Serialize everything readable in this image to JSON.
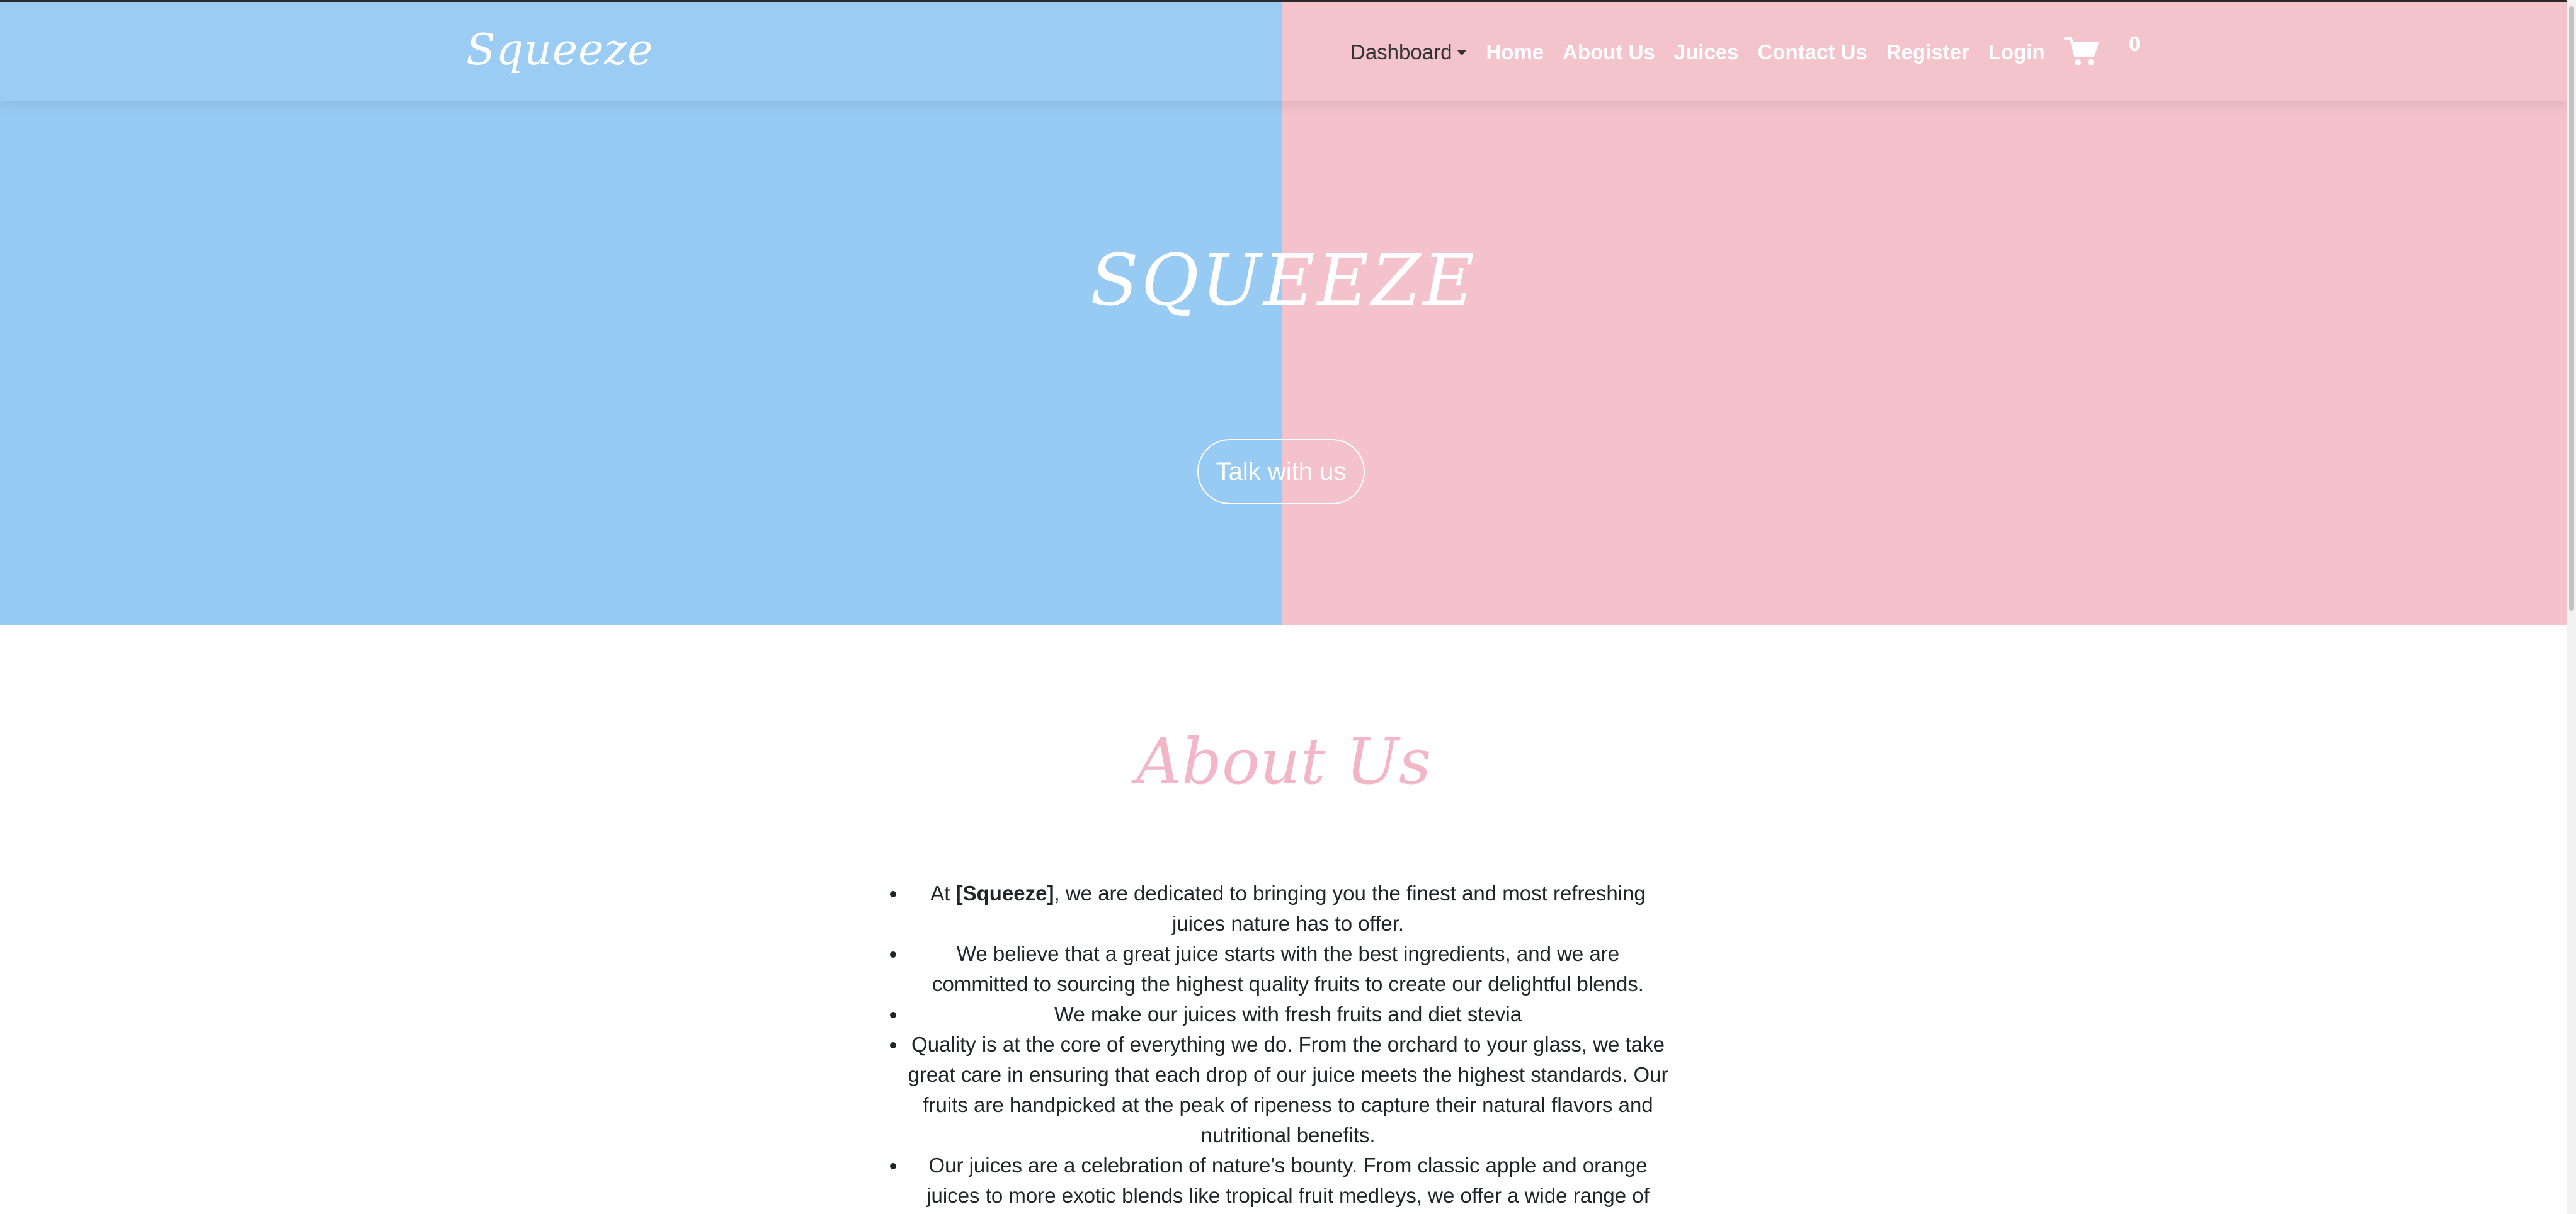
{
  "navbar": {
    "brand": "Squeeze",
    "dropdown_label": "Dashboard",
    "links": [
      "Home",
      "About Us",
      "Juices",
      "Contact Us",
      "Register",
      "Login"
    ],
    "cart_count": "0",
    "cart_icon": "shopping-cart-icon"
  },
  "hero": {
    "title": "SQUEEZE",
    "button_label": "Talk with us"
  },
  "about": {
    "heading": "About Us",
    "item1_prefix": "At ",
    "item1_bold": "[Squeeze]",
    "item1_suffix": ", we are dedicated to bringing you the finest and most refreshing juices nature has to offer.",
    "item2": "We believe that a great juice starts with the best ingredients, and we are committed to sourcing the highest quality fruits to create our delightful blends.",
    "item3": "We make our juices with fresh fruits and diet stevia",
    "item4": "Quality is at the core of everything we do. From the orchard to your glass, we take great care in ensuring that each drop of our juice meets the highest standards. Our fruits are handpicked at the peak of ripeness to capture their natural flavors and nutritional benefits.",
    "item5": "Our juices are a celebration of nature's bounty. From classic apple and orange juices to more exotic blends like tropical fruit medleys, we offer a wide range of"
  },
  "colors": {
    "hero_left": "#98cbf3",
    "hero_right": "#f4c2cc",
    "about_heading": "#f3b6c6"
  }
}
